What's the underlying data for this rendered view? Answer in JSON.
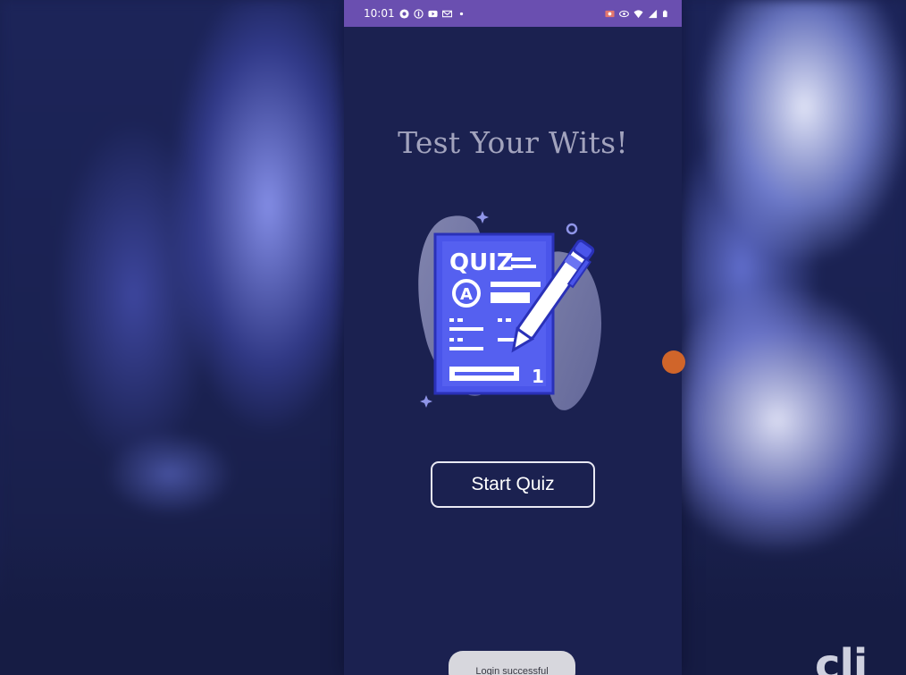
{
  "status_bar": {
    "time": "10:01",
    "left_icons": [
      "notification-icon",
      "facebook-icon",
      "youtube-icon",
      "gmail-icon",
      "dot-icon"
    ],
    "right_icons": [
      "screen-record-icon",
      "eye-icon",
      "wifi-icon",
      "signal-icon",
      "battery-icon"
    ]
  },
  "screen": {
    "title": "Test Your Wits!",
    "illustration": {
      "icon": "quiz-paper-with-pen-icon",
      "quiz_text": "QUIZ",
      "answer_letter": "A",
      "page_number": "1"
    },
    "start_button_label": "Start Quiz"
  },
  "toast": {
    "text": "Login successful"
  },
  "watermark": {
    "text": "cli"
  },
  "colors": {
    "status_bar": "#6a4fb0",
    "screen_background": "#1b2150",
    "title": "#a2a3bd",
    "illustration_blue": "#4a55ea",
    "button_border": "#e9e9f3",
    "floating_dot": "#d0652a"
  }
}
